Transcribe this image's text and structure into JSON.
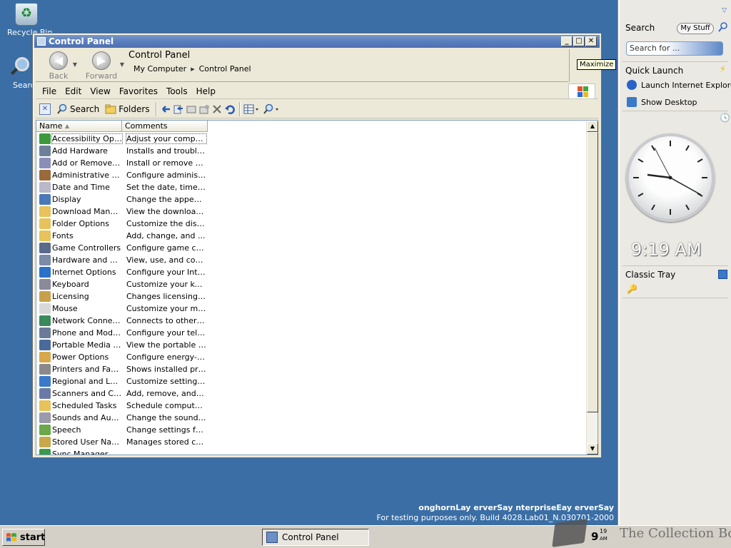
{
  "desktop": {
    "recycle_label": "Recycle Bin",
    "search_label": "Search"
  },
  "window": {
    "title": "Control Panel",
    "minimize": "_",
    "maximize": "□",
    "close": "✕",
    "tooltip": "Maximize"
  },
  "nav": {
    "back": "Back",
    "forward": "Forward",
    "heading": "Control Panel",
    "crumbs": [
      "My Computer",
      "Control Panel"
    ]
  },
  "menu": [
    "File",
    "Edit",
    "View",
    "Favorites",
    "Tools",
    "Help"
  ],
  "toolbar": {
    "search": "Search",
    "folders": "Folders"
  },
  "list": {
    "columns": [
      "Name",
      "Comments"
    ],
    "rows": [
      {
        "name": "Accessibility Opti...",
        "comment": "Adjust your comput...",
        "color": "#3c9a3c"
      },
      {
        "name": "Add Hardware",
        "comment": "Installs and trouble...",
        "color": "#6e7f9a"
      },
      {
        "name": "Add or Remove P...",
        "comment": "Install or remove pr...",
        "color": "#8a8fb8"
      },
      {
        "name": "Administrative Tools",
        "comment": "Configure administr...",
        "color": "#9a6a3a"
      },
      {
        "name": "Date and Time",
        "comment": "Set the date, time, ...",
        "color": "#b8b8c8"
      },
      {
        "name": "Display",
        "comment": "Change the appear...",
        "color": "#4a78b8"
      },
      {
        "name": "Download Manager",
        "comment": "View the downloads...",
        "color": "#e8c25a"
      },
      {
        "name": "Folder Options",
        "comment": "Customize the displ...",
        "color": "#e8c25a"
      },
      {
        "name": "Fonts",
        "comment": "Add, change, and ...",
        "color": "#e8c25a"
      },
      {
        "name": "Game Controllers",
        "comment": "Configure game con...",
        "color": "#5a6a8a"
      },
      {
        "name": "Hardware and De...",
        "comment": "View, use, and conf...",
        "color": "#7a8aa8"
      },
      {
        "name": "Internet Options",
        "comment": "Configure your Inte...",
        "color": "#2a72c8"
      },
      {
        "name": "Keyboard",
        "comment": "Customize your key...",
        "color": "#8a8a9a"
      },
      {
        "name": "Licensing",
        "comment": "Changes licensing o...",
        "color": "#c8a04a"
      },
      {
        "name": "Mouse",
        "comment": "Customize your mo...",
        "color": "#d8d8d8"
      },
      {
        "name": "Network Connect...",
        "comment": "Connects to other c...",
        "color": "#3a8a5a"
      },
      {
        "name": "Phone and Mode...",
        "comment": "Configure your tele...",
        "color": "#6a7a9a"
      },
      {
        "name": "Portable Media D...",
        "comment": "View the portable m...",
        "color": "#4a6a9a"
      },
      {
        "name": "Power Options",
        "comment": "Configure energy-s...",
        "color": "#d8a84a"
      },
      {
        "name": "Printers and Faxes",
        "comment": "Shows installed prin...",
        "color": "#8a8a8a"
      },
      {
        "name": "Regional and Lan...",
        "comment": "Customize settings ...",
        "color": "#3a7ac8"
      },
      {
        "name": "Scanners and Ca...",
        "comment": "Add, remove, and c...",
        "color": "#6a7aa8"
      },
      {
        "name": "Scheduled Tasks",
        "comment": "Schedule computer ...",
        "color": "#e8c25a"
      },
      {
        "name": "Sounds and Audi...",
        "comment": "Change the sound s...",
        "color": "#9a9aaa"
      },
      {
        "name": "Speech",
        "comment": "Change settings for...",
        "color": "#6aa84a"
      },
      {
        "name": "Stored User Nam...",
        "comment": "Manages stored cre...",
        "color": "#c8a84a"
      },
      {
        "name": "Sync Manager",
        "comment": "",
        "color": "#3a9a4a"
      }
    ]
  },
  "watermark": {
    "line1": "onghornLay erverSay nterpriseEay erverSay",
    "line2": "For testing purposes only. Build 4028.Lab01_N.030701-2000"
  },
  "taskbar": {
    "start": "start",
    "task": "Control Panel",
    "time_hour": "9",
    "time_min": "19",
    "ampm": "AM",
    "collection": "The Collection Book"
  },
  "sidebar": {
    "search_title": "Search",
    "mystuff": "My Stuff",
    "search_placeholder": "Search for ...",
    "quick_launch": "Quick Launch",
    "ql_items": [
      "Launch Internet Explorer",
      "Show Desktop"
    ],
    "clock_time": "9:19 AM",
    "classic_tray": "Classic Tray"
  }
}
